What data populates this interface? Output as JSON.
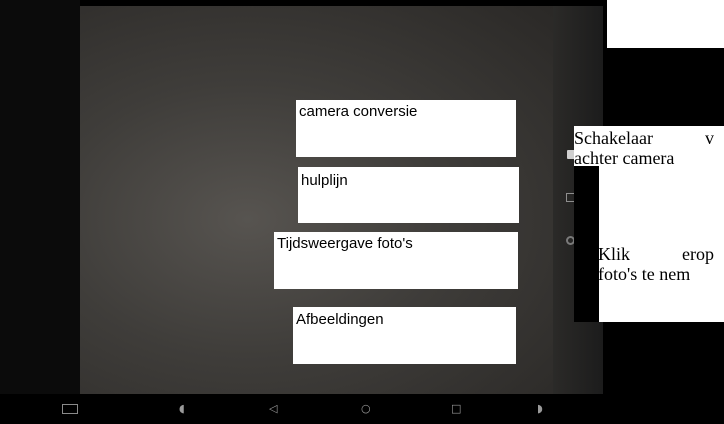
{
  "overlay_labels": {
    "camera_conversion": "camera conversie",
    "guideline": "hulplijn",
    "photo_timing": "Tijdsweergave foto's",
    "images": "Afbeeldingen"
  },
  "instruction": {
    "line1_word1": "Schakelaar",
    "line1_word2": "v",
    "line2": "achter camera",
    "line3_word1": "Klik",
    "line3_word2": "erop",
    "line4": "foto's te nem"
  },
  "nav_icons": [
    "screenshot-icon",
    "volume-down-icon",
    "back-icon",
    "home-icon",
    "recents-icon",
    "volume-up-icon"
  ],
  "colors": {
    "viewfinder": "#4a4744",
    "overlay": "#ffffff",
    "bezel": "#000000"
  }
}
